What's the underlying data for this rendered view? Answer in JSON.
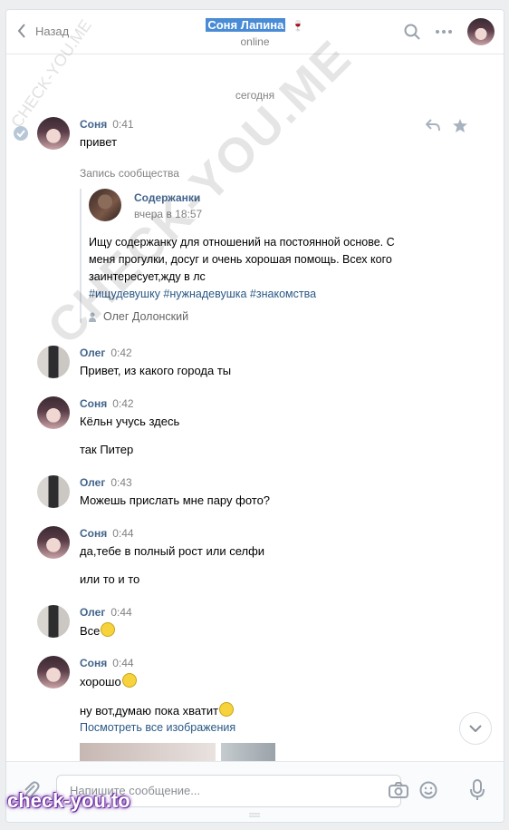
{
  "header": {
    "back_label": "Назад",
    "peer_name": "Соня Лапина",
    "peer_status": "online"
  },
  "date_separator": "сегодня",
  "messages": [
    {
      "author": "Соня",
      "time": "0:41",
      "lines": [
        "привет"
      ],
      "repost": {
        "label": "Запись сообщества",
        "group_name": "Содержанки",
        "group_time": "вчера в 18:57",
        "text": "Ищу содержанку для отношений на постоянной основе. С меня прогулки, досуг и очень хорошая помощь. Всех кого заинтересует,жду в лс",
        "tags": "#ищудевушку #нужнадевушка #знакомства",
        "signer": "Олег Долонский"
      }
    },
    {
      "author": "Олег",
      "time": "0:42",
      "lines": [
        "Привет, из какого города ты"
      ]
    },
    {
      "author": "Соня",
      "time": "0:42",
      "lines": [
        "Кёльн учусь здесь",
        "так Питер"
      ]
    },
    {
      "author": "Олег",
      "time": "0:43",
      "lines": [
        "Можешь прислать мне пару фото?"
      ]
    },
    {
      "author": "Соня",
      "time": "0:44",
      "lines": [
        "да,тебе в полный рост или селфи",
        "или то и то"
      ]
    },
    {
      "author": "Олег",
      "time": "0:44",
      "lines": [
        "Все"
      ]
    },
    {
      "author": "Соня",
      "time": "0:44",
      "lines": [
        "хорошо",
        "ну вот,думаю пока хватит"
      ],
      "link": "Посмотреть все изображения"
    }
  ],
  "composer": {
    "placeholder": "Напишите сообщение..."
  },
  "watermarks": {
    "diagonal": "CHECK-YOU.ME",
    "corner": "CHECK-YOU.ME",
    "logo": "check-you.to"
  },
  "colors": {
    "accent": "#42648b",
    "link": "#2a5885",
    "muted": "#828282",
    "highlight": "#4a8bd6"
  }
}
